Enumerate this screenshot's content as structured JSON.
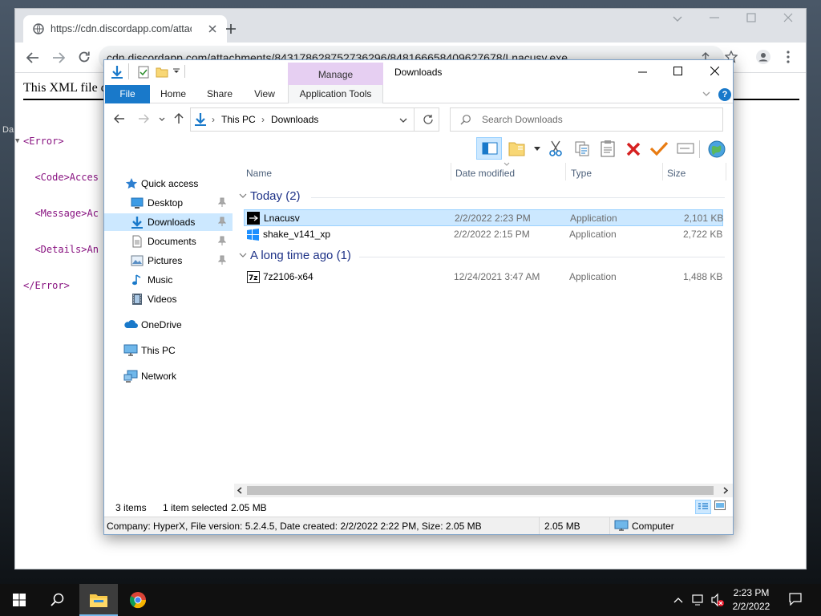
{
  "chrome": {
    "tab_title": "https://cdn.discordapp.com/attac",
    "url": "cdn.discordapp.com/attachments/843178628752736296/848166658409627678/Lnacusv.exe"
  },
  "xml_page": {
    "banner": "This XML file d",
    "lines": [
      "<Error>",
      "  <Code>Acces",
      "  <Message>Ac",
      "  <Details>An",
      "</Error>"
    ],
    "side_fragments": [
      "Da"
    ]
  },
  "explorer": {
    "title": "Downloads",
    "context_tab": "Manage",
    "tabs": {
      "file": "File",
      "home": "Home",
      "share": "Share",
      "view": "View",
      "app_tools": "Application Tools"
    },
    "breadcrumb": [
      "This PC",
      "Downloads"
    ],
    "search_placeholder": "Search Downloads",
    "columns": {
      "name": "Name",
      "date": "Date modified",
      "type": "Type",
      "size": "Size"
    },
    "groups": [
      {
        "label": "Today (2)",
        "files": [
          {
            "name": "Lnacusv",
            "date": "2/2/2022 2:23 PM",
            "type": "Application",
            "size": "2,101 KB",
            "selected": true
          },
          {
            "name": "shake_v141_xp",
            "date": "2/2/2022 2:15 PM",
            "type": "Application",
            "size": "2,722 KB",
            "selected": false
          }
        ]
      },
      {
        "label": "A long time ago (1)",
        "files": [
          {
            "name": "7z2106-x64",
            "date": "12/24/2021 3:47 AM",
            "type": "Application",
            "size": "1,488 KB",
            "selected": false
          }
        ]
      }
    ],
    "nav": {
      "quick_access": "Quick access",
      "desktop": "Desktop",
      "downloads": "Downloads",
      "documents": "Documents",
      "pictures": "Pictures",
      "music": "Music",
      "videos": "Videos",
      "onedrive": "OneDrive",
      "this_pc": "This PC",
      "network": "Network"
    },
    "status": {
      "items": "3 items",
      "selected": "1 item selected",
      "selected_size": "2.05 MB"
    },
    "details": {
      "info": "Company: HyperX, File version: 5.2.4.5, Date created: 2/2/2022 2:22 PM, Size: 2.05 MB",
      "size": "2.05 MB",
      "location": "Computer"
    }
  },
  "taskbar": {
    "time": "2:23 PM",
    "date": "2/2/2022"
  }
}
